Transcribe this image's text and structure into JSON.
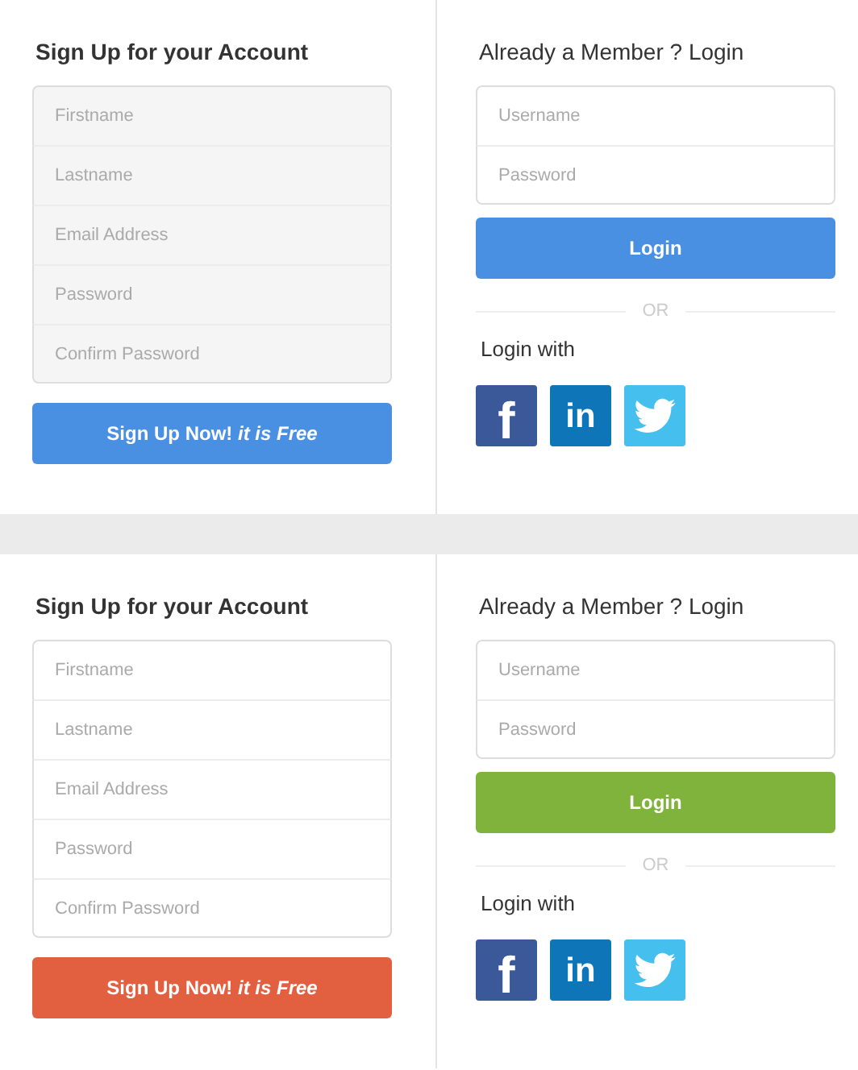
{
  "panels": [
    {
      "signup": {
        "title": "Sign Up for your Account",
        "color": "#f5f5f5",
        "fields": [
          {
            "placeholder": "Firstname"
          },
          {
            "placeholder": "Lastname"
          },
          {
            "placeholder": "Email Address"
          },
          {
            "placeholder": "Password"
          },
          {
            "placeholder": "Confirm Password"
          }
        ],
        "button": {
          "label": "Sign Up Now! *it is Free*",
          "color": "#4a90e2"
        }
      },
      "login": {
        "title": "Already a Member ? Login",
        "fields": [
          {
            "placeholder": "Username"
          },
          {
            "placeholder": "Password"
          }
        ],
        "button": {
          "label": "Login",
          "color": "#4a90e2"
        },
        "divider": "OR",
        "login_with": "Login with",
        "socials": [
          {
            "kind": "facebook",
            "label": "f",
            "color": "#3b5998"
          },
          {
            "kind": "linkedin",
            "label": "in",
            "color": "#0e76b8"
          },
          {
            "kind": "twitter",
            "color": "#45c0ee"
          }
        ]
      }
    },
    {
      "signup": {
        "title": "Sign Up for your Account",
        "color": "#ffffff",
        "fields": [
          {
            "placeholder": "Firstname"
          },
          {
            "placeholder": "Lastname"
          },
          {
            "placeholder": "Email Address"
          },
          {
            "placeholder": "Password"
          },
          {
            "placeholder": "Confirm Password"
          }
        ],
        "button": {
          "label": "Sign Up Now! *it is Free*",
          "color": "#e2603f"
        }
      },
      "login": {
        "title": "Already a Member ? Login",
        "fields": [
          {
            "placeholder": "Username"
          },
          {
            "placeholder": "Password"
          }
        ],
        "button": {
          "label": "Login",
          "color": "#80b33c"
        },
        "divider": "OR",
        "login_with": "Login with",
        "socials": [
          {
            "kind": "facebook",
            "label": "f",
            "color": "#3b5998"
          },
          {
            "kind": "linkedin",
            "label": "in",
            "color": "#0e76b8"
          },
          {
            "kind": "twitter",
            "color": "#45c0ee"
          }
        ]
      }
    }
  ]
}
